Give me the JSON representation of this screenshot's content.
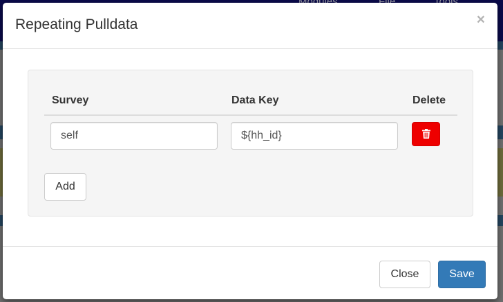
{
  "background": {
    "nav_items": [
      "Modules",
      "File",
      "Tools"
    ]
  },
  "modal": {
    "title": "Repeating Pulldata",
    "close_glyph": "×",
    "table": {
      "columns": [
        "Survey",
        "Data Key",
        "Delete"
      ],
      "rows": [
        {
          "survey": "self",
          "data_key": "${hh_id}"
        }
      ]
    },
    "add_label": "Add",
    "footer": {
      "close_label": "Close",
      "save_label": "Save"
    }
  },
  "colors": {
    "delete_button": "#ee0000",
    "save_button": "#337ab7"
  },
  "icons": {
    "delete": "trash-icon",
    "dismiss": "close-icon"
  }
}
